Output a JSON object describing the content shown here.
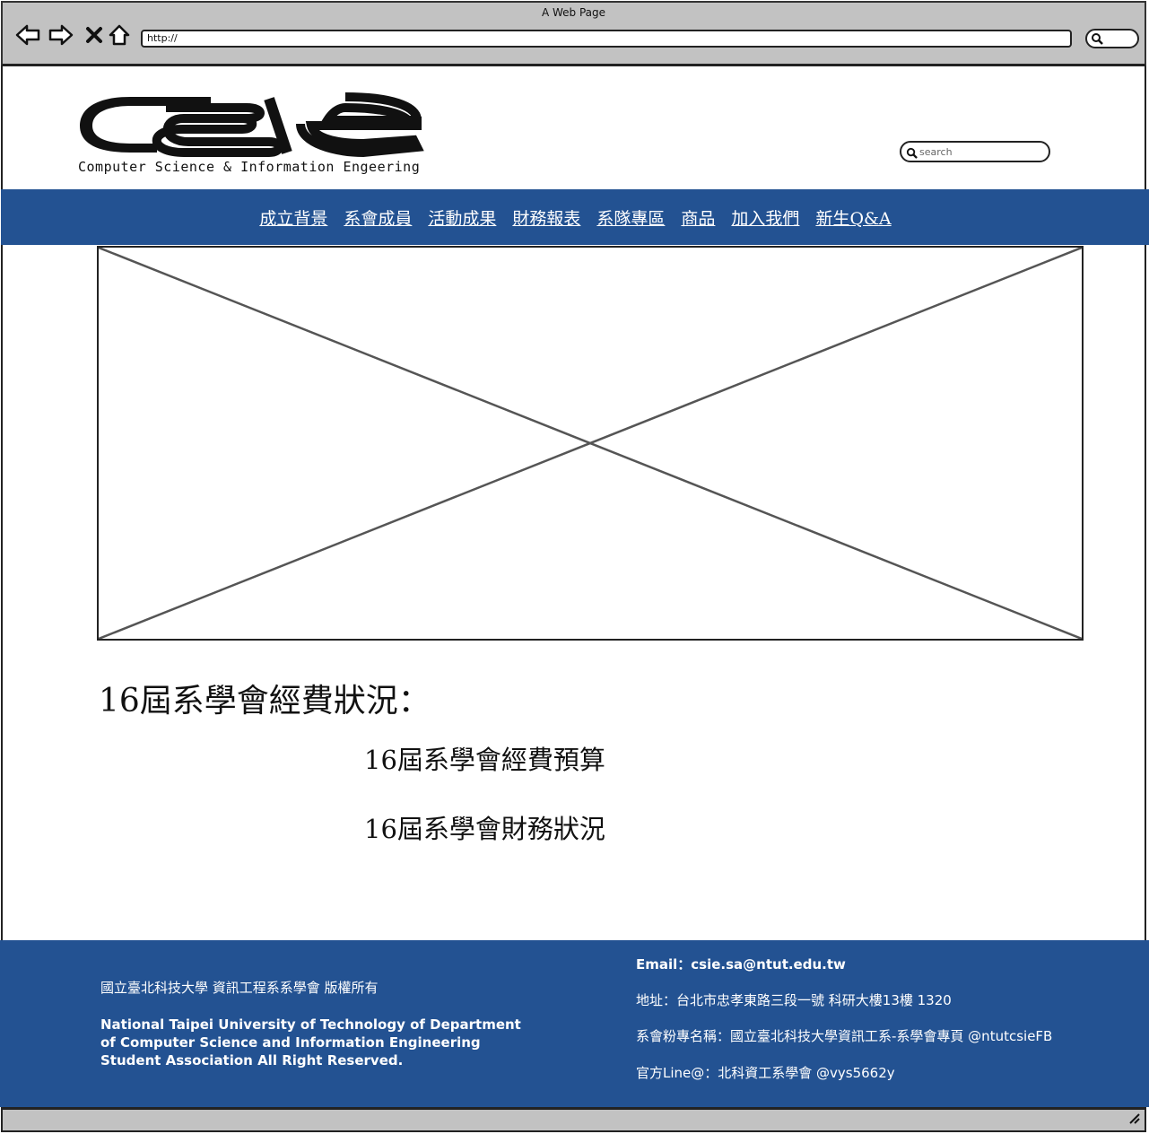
{
  "browser": {
    "title": "A Web Page",
    "url": "http://"
  },
  "header": {
    "logo_text": "csie",
    "logo_subtitle": "Computer Science & Information Engeering",
    "search_placeholder": "search"
  },
  "nav": {
    "items": [
      {
        "label": "成立背景"
      },
      {
        "label": "系會成員"
      },
      {
        "label": "活動成果"
      },
      {
        "label": "財務報表"
      },
      {
        "label": "系隊專區"
      },
      {
        "label": "商品"
      },
      {
        "label": "加入我們"
      },
      {
        "label": "新生Q&A"
      }
    ]
  },
  "main": {
    "heading": "16屆系學會經費狀況：",
    "links": [
      {
        "label": "16屆系學會經費預算"
      },
      {
        "label": "16屆系學會財務狀況"
      }
    ]
  },
  "footer": {
    "copyright_cn": "國立臺北科技大學 資訊工程系系學會 版權所有",
    "copyright_en": "National Taipei University of Technology of Department of Computer Science and Information Engineering Student Association All Right Reserved.",
    "email": "Email：csie.sa@ntut.edu.tw",
    "address": "地址：台北市忠孝東路三段一號 科研大樓13樓 1320",
    "fanpage": "系會粉專名稱：國立臺北科技大學資訊工系-系學會專頁 @ntutcsieFB",
    "line": "官方Line@：北科資工系學會 @vys5662y"
  },
  "colors": {
    "brand_blue": "#235292",
    "chrome_gray": "#c2c2c2"
  }
}
